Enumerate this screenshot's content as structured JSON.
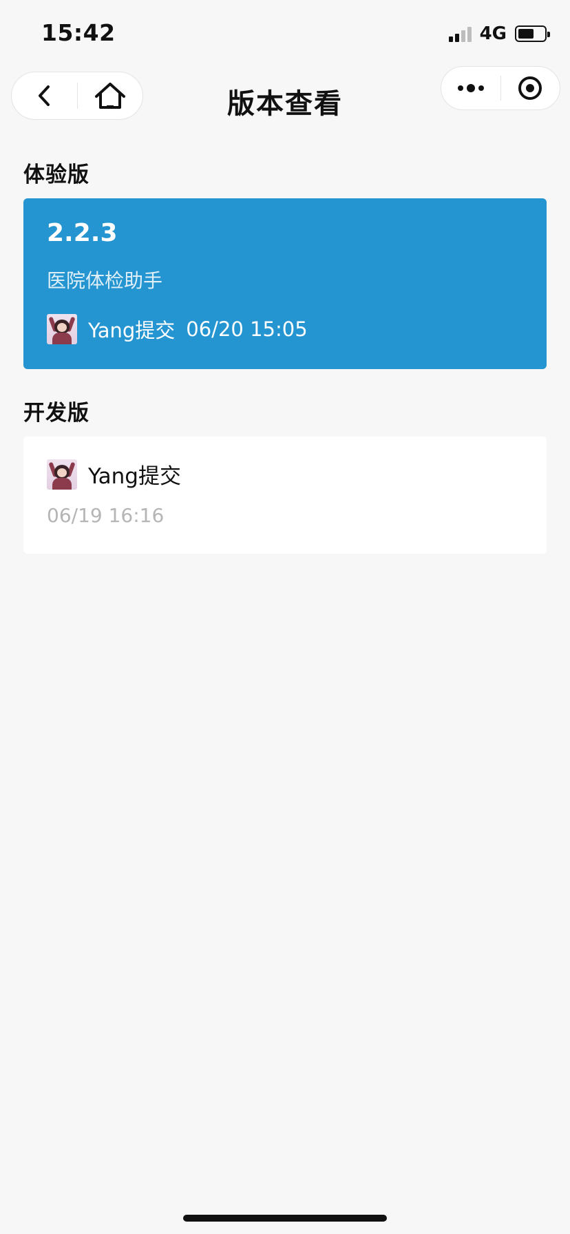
{
  "status_bar": {
    "time": "15:42",
    "network": "4G",
    "battery_level": 0.6
  },
  "nav": {
    "title": "版本查看",
    "back_icon": "chevron-left-icon",
    "home_icon": "home-icon",
    "more_icon": "more-dots-icon",
    "close_icon": "target-circle-icon"
  },
  "trial_section": {
    "title": "体验版",
    "version": "2.2.3",
    "description": "医院体检助手",
    "submitter": "Yang提交",
    "submitted_at": "06/20 15:05",
    "card_color": "#2595d1"
  },
  "dev_section": {
    "title": "开发版",
    "submitter": "Yang提交",
    "submitted_at": "06/19 16:16"
  }
}
